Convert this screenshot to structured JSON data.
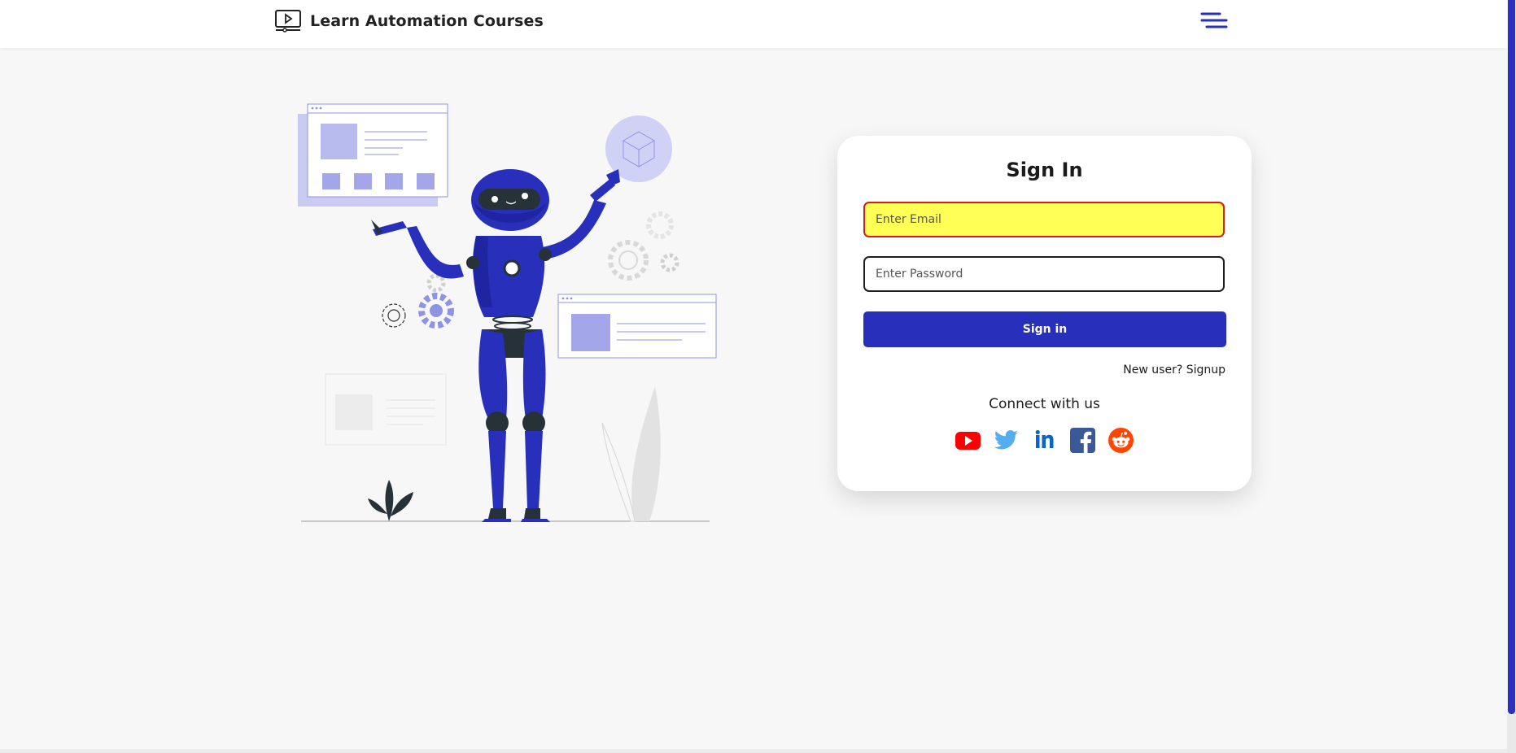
{
  "header": {
    "brand_title": "Learn Automation Courses",
    "brand_icon": "video-player-icon",
    "menu_icon": "hamburger-menu-icon"
  },
  "illustration": {
    "subject": "robot-illustration"
  },
  "login": {
    "title": "Sign In",
    "email_placeholder": "Enter Email",
    "email_value": "",
    "password_placeholder": "Enter Password",
    "password_value": "",
    "submit_label": "Sign in",
    "signup_link": "New user? Signup",
    "connect_heading": "Connect with us",
    "socials": [
      {
        "name": "youtube-icon",
        "color": "#ff0000"
      },
      {
        "name": "twitter-icon",
        "color": "#55acee"
      },
      {
        "name": "linkedin-icon",
        "color": "#0a66c2"
      },
      {
        "name": "facebook-icon",
        "color": "#3b5998"
      },
      {
        "name": "reddit-icon",
        "color": "#ff4500"
      }
    ]
  },
  "colors": {
    "accent": "#2830bb",
    "email_highlight": "#ffff55",
    "email_border": "#d41c1c",
    "page_bg": "#f6f7f6"
  }
}
